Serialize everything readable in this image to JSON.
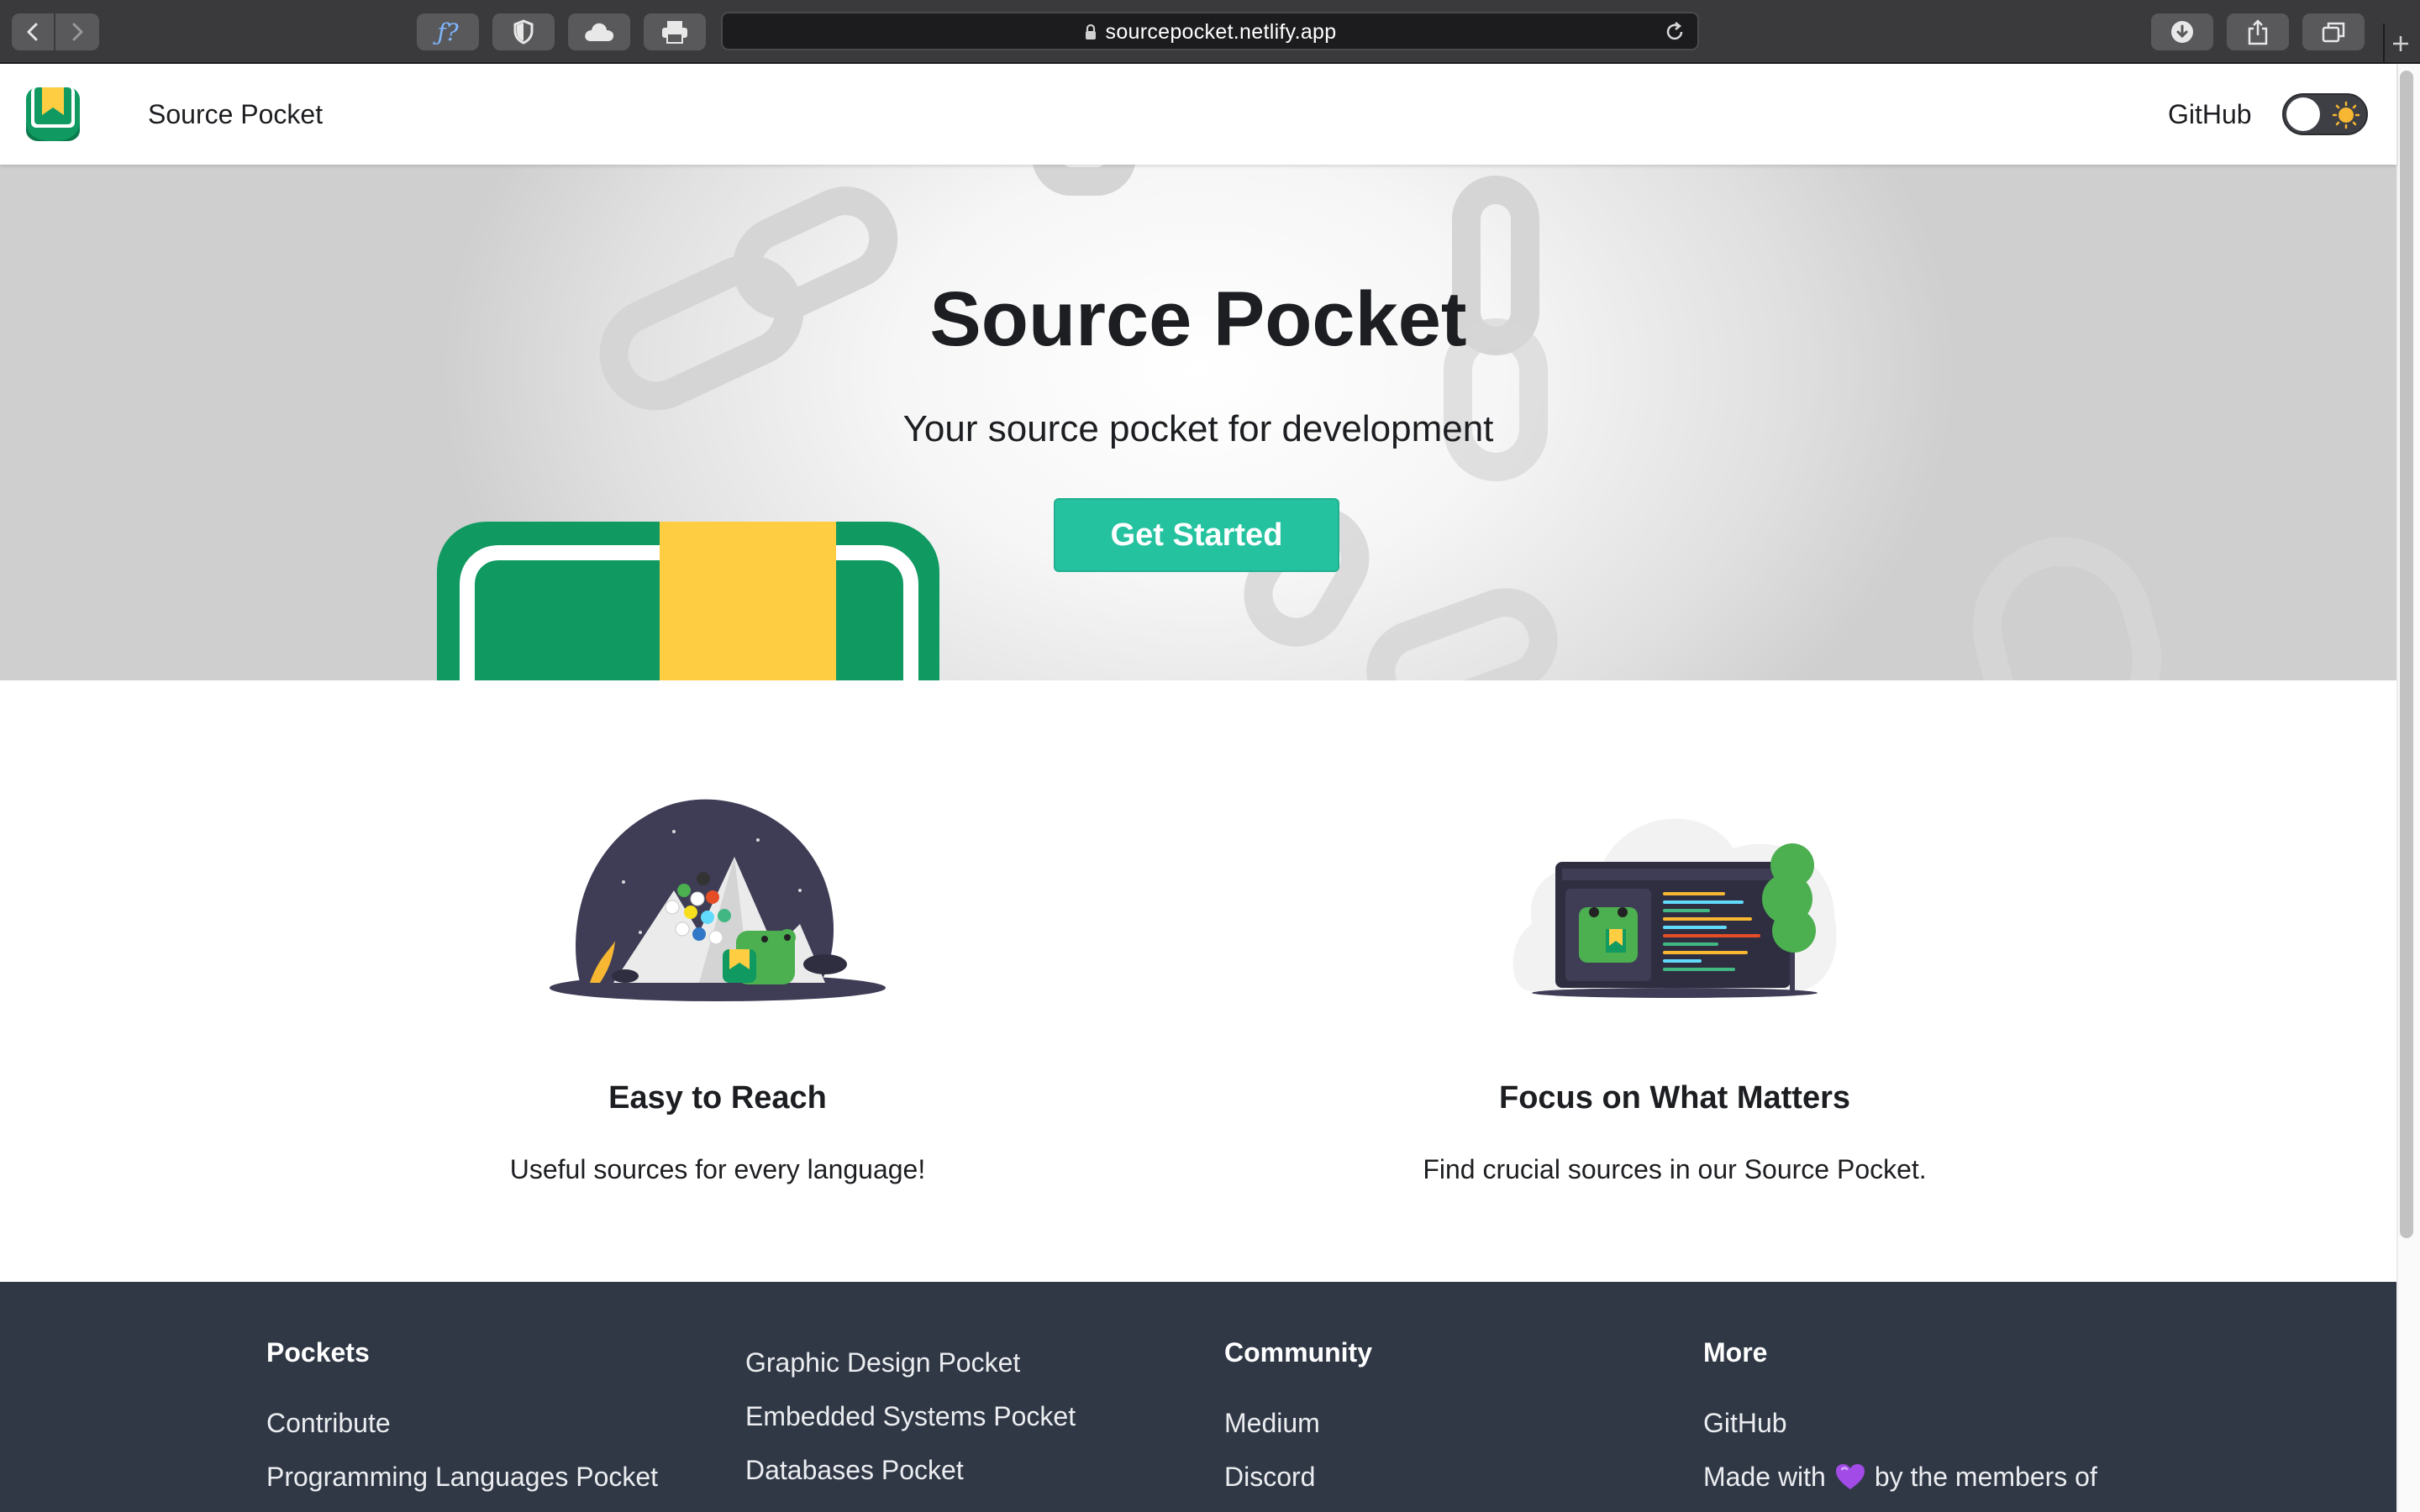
{
  "browser": {
    "url": "sourcepocket.netlify.app",
    "toolbar_icons": [
      "back-icon",
      "forward-icon",
      "formula-icon",
      "shield-icon",
      "cloud-icon",
      "print-icon",
      "download-icon",
      "share-icon",
      "tabs-icon",
      "plus-icon"
    ]
  },
  "navbar": {
    "brand": "Source Pocket",
    "github": "GitHub",
    "theme_toggle_icon": "sun-icon"
  },
  "hero": {
    "title": "Source Pocket",
    "subtitle": "Your source pocket for development",
    "cta": "Get Started"
  },
  "features": [
    {
      "title": "Easy to Reach",
      "description": "Useful sources for every language!"
    },
    {
      "title": "Focus on What Matters",
      "description": "Find crucial sources in our Source Pocket."
    }
  ],
  "footer": {
    "col1": {
      "title": "Pockets",
      "links": [
        "Contribute",
        "Programming Languages Pocket"
      ]
    },
    "col2": {
      "links": [
        "Graphic Design Pocket",
        "Embedded Systems Pocket",
        "Databases Pocket"
      ]
    },
    "col3": {
      "title": "Community",
      "links": [
        "Medium",
        "Discord"
      ]
    },
    "col4": {
      "title": "More",
      "links": [
        "GitHub"
      ],
      "made_with_prefix": "Made with",
      "made_with_suffix": "by the members of"
    }
  },
  "colors": {
    "primary": "#25c2a0",
    "footer_bg": "#303846",
    "logo_green": "#109a62",
    "logo_yellow": "#ffcd42"
  }
}
